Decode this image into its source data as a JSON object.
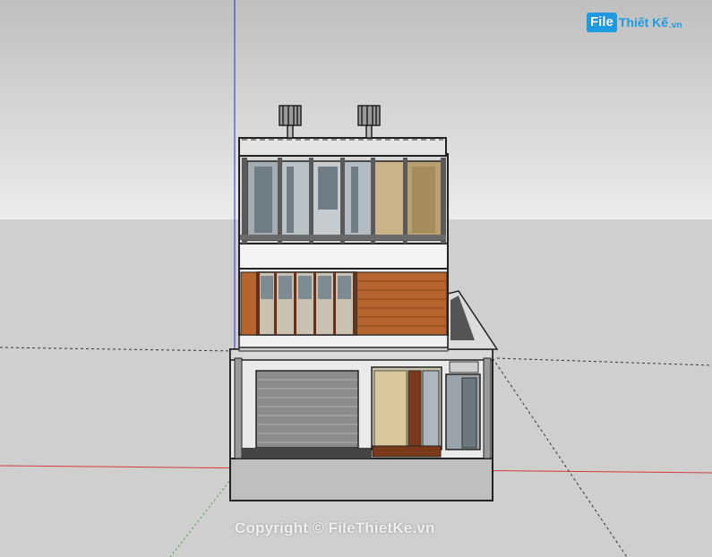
{
  "logo": {
    "badge": "File",
    "name": "Thiết Kế",
    "tld": ".vn"
  },
  "watermark": {
    "text": "Copyright © FileThietKe.vn"
  },
  "scene": {
    "axes": {
      "red": "#d83a3a",
      "green": "#3a9a3a",
      "blue": "#2a2ae0"
    },
    "colors": {
      "sky_top": "#bfbfbf",
      "ground": "#cfcfcf",
      "wall": "#e8e8e8",
      "wood": "#b5652d",
      "glass": "#8e9ca6",
      "frame": "#5a5a5a"
    }
  }
}
